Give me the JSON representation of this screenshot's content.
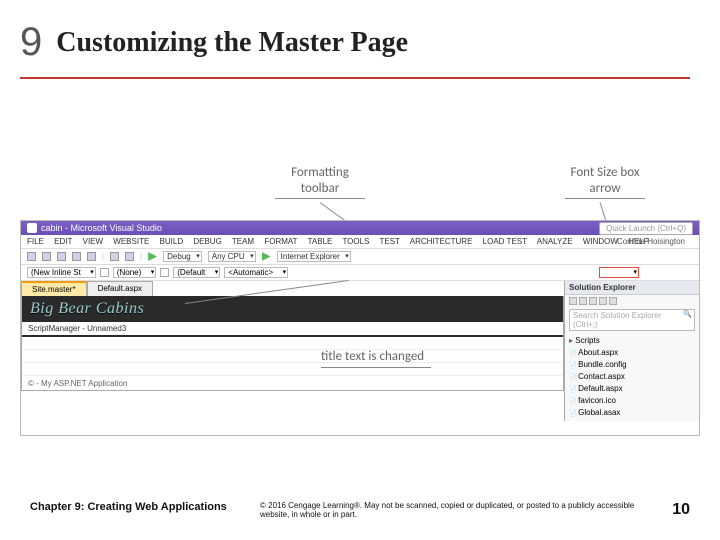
{
  "header": {
    "chapter_number": "9",
    "title": "Customizing the Master Page"
  },
  "callouts": {
    "formatting_toolbar": "Formatting toolbar",
    "font_size_arrow": "Font Size box arrow",
    "title_changed": "title text is changed"
  },
  "vs": {
    "window_title": "cabin - Microsoft Visual Studio",
    "quick_launch": "Quick Launch (Ctrl+Q)",
    "author": "Corinne Hoisington",
    "menu": [
      "FILE",
      "EDIT",
      "VIEW",
      "WEBSITE",
      "BUILD",
      "DEBUG",
      "TEAM",
      "FORMAT",
      "TABLE",
      "TOOLS",
      "TEST",
      "ARCHITECTURE",
      "LOAD TEST",
      "ANALYZE",
      "WINDOW",
      "HELP"
    ],
    "toolbar": {
      "config": "Debug",
      "cpu": "Any CPU",
      "browser": "Internet Explorer",
      "new_style": "(New Inline St",
      "rule_none": "(None)",
      "font_default": "(Default",
      "font_auto": "<Automatic>"
    },
    "tabs": {
      "active": "Site.master*",
      "inactive": "Default.aspx"
    },
    "banner_text": "Big Bear Cabins",
    "script_manager": "ScriptManager - Unnamed3",
    "footer_line": "© - My ASP.NET Application"
  },
  "solution_explorer": {
    "title": "Solution Explorer",
    "search_placeholder": "Search Solution Explorer (Ctrl+;)",
    "items": [
      {
        "type": "node",
        "label": "Scripts"
      },
      {
        "type": "file",
        "label": "About.aspx"
      },
      {
        "type": "file",
        "label": "Bundle.config"
      },
      {
        "type": "file",
        "label": "Contact.aspx"
      },
      {
        "type": "file",
        "label": "Default.aspx"
      },
      {
        "type": "file",
        "label": "favicon.ico"
      },
      {
        "type": "file",
        "label": "Global.asax"
      }
    ]
  },
  "footer": {
    "chapter": "Chapter 9: Creating Web Applications",
    "copyright": "© 2016 Cengage Learning®. May not be scanned, copied or duplicated, or posted to a publicly accessible website, in whole or in part.",
    "page": "10"
  }
}
